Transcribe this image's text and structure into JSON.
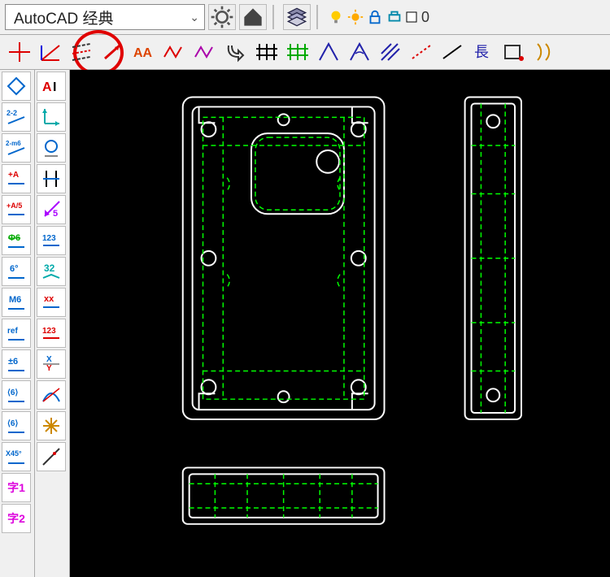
{
  "workspace": {
    "label": "AutoCAD 经典"
  },
  "top_icons": {
    "gear": "gear-icon",
    "home": "home-icon",
    "layers": "layers-icon"
  },
  "layer": {
    "name": "0"
  },
  "htools": {
    "t1": "crosshair",
    "t2": "perpendicular",
    "t3": "dashed-lines",
    "t4": "slope-red",
    "t5": "AA-red",
    "t6": "zigzag-red",
    "t7": "zigzag-purple",
    "t8": "hook",
    "t9": "fence-black",
    "t10": "fence-green",
    "t11": "angle1",
    "t12": "angle2",
    "t13": "hatch",
    "t14": "red-dash",
    "t15": "black-line",
    "t16": "長",
    "t17": "rect-dot",
    "t18": "arc-pair"
  },
  "v1": {
    "i1": "diamond",
    "i2": "line-22-up",
    "i3": "line-22-down",
    "i4": "2-m6",
    "i5": "plus-A",
    "i6": "A/5",
    "i7": "Φ6",
    "i8": "6°",
    "i9": "M6",
    "i10": "ref",
    "i11": "±6",
    "i12": "⟨6⟩",
    "i13": "⟨6⟩-alt",
    "i14": "X45°",
    "i15": "字1",
    "i16": "字2"
  },
  "v2": {
    "i1": "AI",
    "i2": "axes",
    "i3": "circle",
    "i4": "H-bar",
    "i5": "arrow-5",
    "i6": "123-blue",
    "i7": "32-cyan",
    "i8": "xx-red",
    "i9": "123-red",
    "i10": "XY-blue",
    "i11": "arc-blue",
    "i12": "star",
    "i13": "line-diag"
  }
}
